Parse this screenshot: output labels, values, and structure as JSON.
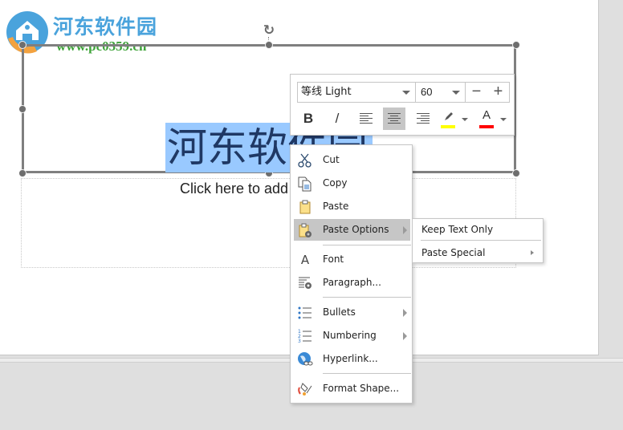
{
  "watermark": {
    "title": "河东软件园",
    "url": "www.pc0359.cn"
  },
  "slide": {
    "title_text": "河东软件园",
    "subtitle_placeholder": "Click here to add subtitle"
  },
  "mini_toolbar": {
    "font_name": "等线 Light",
    "font_size": "60",
    "decrease_label": "−",
    "increase_label": "+",
    "bold_label": "B",
    "italic_label": "/",
    "font_color_label": "A",
    "highlight_color": "#ffff00",
    "font_color": "#ff0000",
    "active_alignment": "center"
  },
  "context_menu": {
    "items": [
      {
        "label": "Cut",
        "icon": "scissors-icon"
      },
      {
        "label": "Copy",
        "icon": "copy-icon"
      },
      {
        "label": "Paste",
        "icon": "clipboard-icon"
      },
      {
        "label": "Paste Options",
        "icon": "paste-options-icon",
        "submenu": true,
        "highlighted": true
      },
      {
        "label": "Font",
        "icon": "font-icon"
      },
      {
        "label": "Paragraph...",
        "icon": "paragraph-icon"
      },
      {
        "label": "Bullets",
        "icon": "bullets-icon",
        "submenu": true
      },
      {
        "label": "Numbering",
        "icon": "numbering-icon",
        "submenu": true
      },
      {
        "label": "Hyperlink...",
        "icon": "hyperlink-icon"
      },
      {
        "label": "Format Shape...",
        "icon": "format-shape-icon"
      }
    ]
  },
  "paste_submenu": {
    "items": [
      {
        "label": "Keep Text Only"
      },
      {
        "label": "Paste Special",
        "submenu": true
      }
    ]
  }
}
